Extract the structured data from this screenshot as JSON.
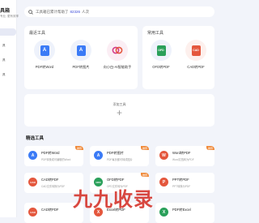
{
  "app": {
    "logo_text": "具箱",
    "logo_sub": "专业, 更有效率"
  },
  "sidebar": {
    "items": [
      {
        "label": ""
      },
      {
        "label": "具"
      },
      {
        "label": "具"
      },
      {
        "label": "具"
      }
    ]
  },
  "search": {
    "placeholder_prefix": "工具箱已累计帮助了",
    "count": "82326",
    "placeholder_suffix": "人次"
  },
  "recent": {
    "title": "最近工具",
    "tools": [
      {
        "label": "PDF转Word",
        "icon": "pdf-word-icon",
        "color": "#3b7bf6"
      },
      {
        "label": "PDF转图片",
        "icon": "pdf-image-icon",
        "color": "#3b7bf6"
      },
      {
        "label": "向小白-AI智能助手",
        "icon": "ai-assistant-icon",
        "color": "#d33a8a"
      }
    ]
  },
  "common": {
    "title": "常用工具",
    "tools": [
      {
        "label": "OFD转PDF",
        "icon": "ofd-pdf-icon",
        "color": "#2aa05a"
      },
      {
        "label": "CAD转PDF",
        "icon": "cad-pdf-icon",
        "color": "#e4573d"
      }
    ]
  },
  "add_tool": {
    "label": "添加工具",
    "plus": "+"
  },
  "featured": {
    "title": "精选工具",
    "cards": [
      {
        "name": "PDF转Word",
        "desc": "PDF转换成可编辑的Word",
        "badge": "推荐",
        "icon": "pdf-word-icon",
        "color": "#3b7bf6"
      },
      {
        "name": "PDF转图片",
        "desc": "PDF每页都可转成图片",
        "badge": "推荐",
        "icon": "pdf-image-icon",
        "color": "#3b7bf6"
      },
      {
        "name": "Word转PDF",
        "desc": "Word文档转为PDF",
        "badge": "推荐",
        "icon": "word-pdf-icon",
        "color": "#e4573d"
      },
      {
        "name": "CAD转PDF",
        "desc": "CAD文件转换为PDF",
        "badge": "",
        "icon": "cad-pdf-icon",
        "color": "#e4573d"
      },
      {
        "name": "OFD转PDF",
        "desc": "OFD文件转为PDF",
        "badge": "推荐",
        "icon": "ofd-pdf-icon",
        "color": "#2aa05a"
      },
      {
        "name": "PPT转PDF",
        "desc": "PPT转换为PDF",
        "badge": "",
        "icon": "ppt-pdf-icon",
        "color": "#e4573d"
      },
      {
        "name": "CAD转PDF",
        "desc": "",
        "badge": "",
        "icon": "cad-pdf-icon",
        "color": "#e4573d"
      },
      {
        "name": "Excel转PDF",
        "desc": "",
        "badge": "",
        "icon": "excel-pdf-icon",
        "color": "#e4573d"
      },
      {
        "name": "PDF转Excel",
        "desc": "",
        "badge": "",
        "icon": "pdf-excel-icon",
        "color": "#2aa05a"
      }
    ]
  },
  "watermark": {
    "text": "九九收录"
  }
}
